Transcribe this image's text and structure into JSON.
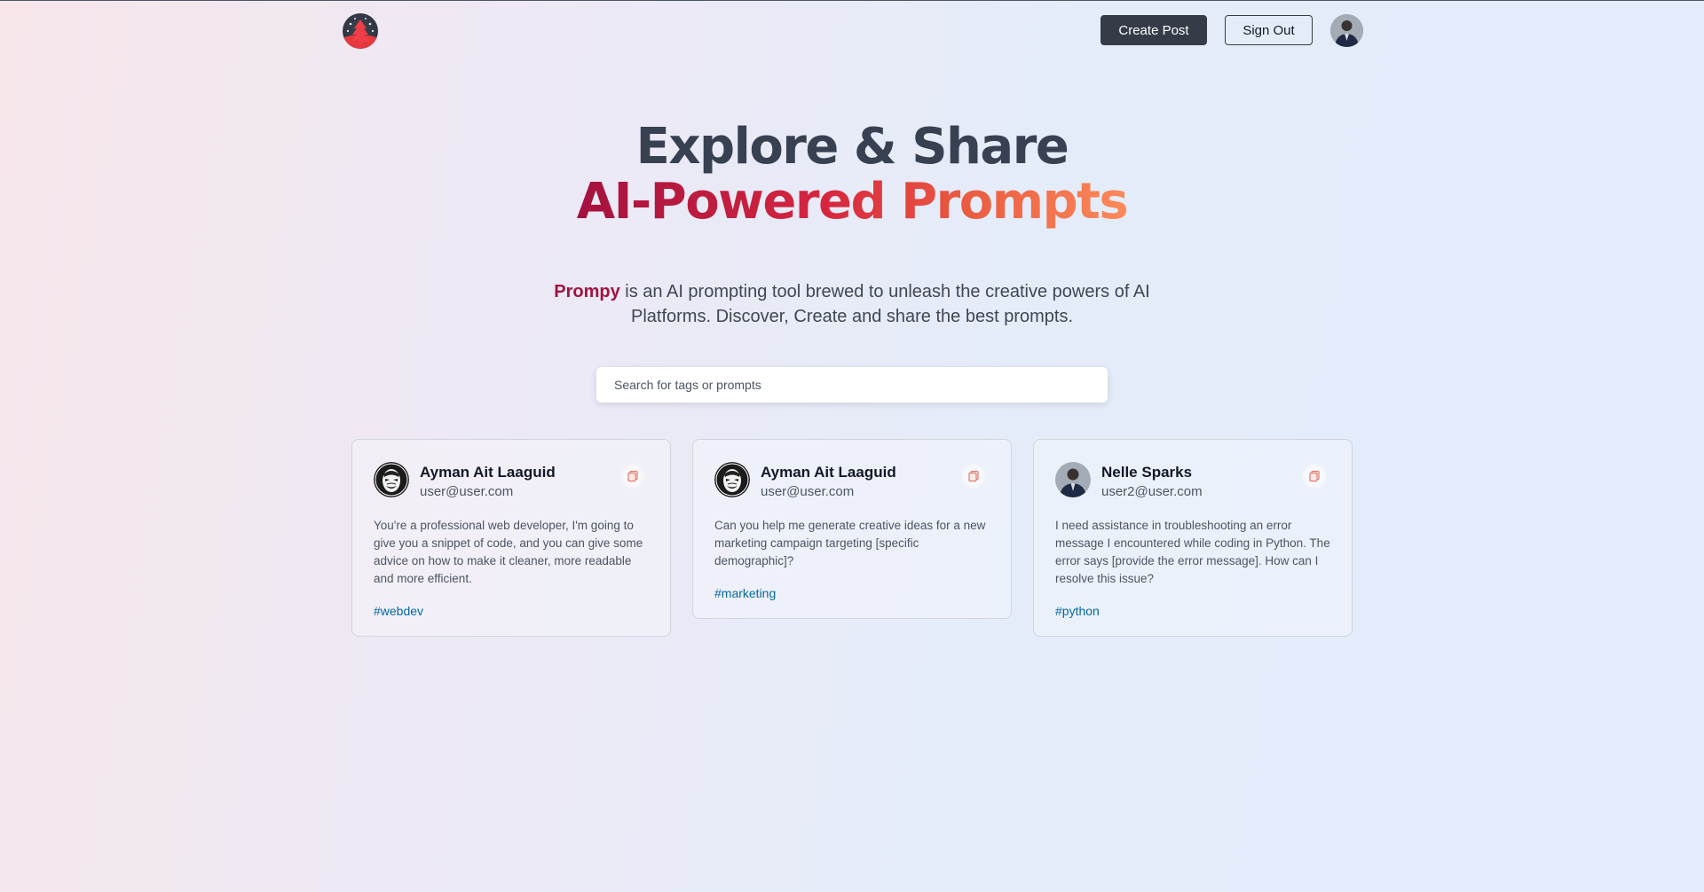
{
  "nav": {
    "create_label": "Create Post",
    "signout_label": "Sign Out"
  },
  "hero": {
    "line1": "Explore & Share",
    "line2": "AI-Powered Prompts",
    "brand": "Prompy",
    "description": " is an AI prompting tool brewed to unleash the creative powers of AI Platforms. Discover, Create and share the best prompts."
  },
  "search": {
    "placeholder": "Search for tags or prompts",
    "value": ""
  },
  "posts": [
    {
      "name": "Ayman Ait Laaguid",
      "email": "user@user.com",
      "text": "You're a professional web developer, I'm going to give you a snippet of code, and you can give some advice on how to make it cleaner, more readable and more efficient.",
      "tag": "#webdev",
      "avatar": "mask-avatar"
    },
    {
      "name": "Ayman Ait Laaguid",
      "email": "user@user.com",
      "text": "Can you help me generate creative ideas for a new marketing campaign targeting [specific demographic]?",
      "tag": "#marketing",
      "avatar": "mask-avatar"
    },
    {
      "name": "Nelle Sparks",
      "email": "user2@user.com",
      "text": "I need assistance in troubleshooting an error message I encountered while coding in Python. The error says [provide the error message]. How can I resolve this issue?",
      "tag": "#python",
      "avatar": "person-avatar"
    }
  ],
  "colors": {
    "brand": "#a4123f",
    "gradient_end": "#fb8a5a",
    "tag": "#0369a1",
    "button_dark": "#353c47"
  }
}
